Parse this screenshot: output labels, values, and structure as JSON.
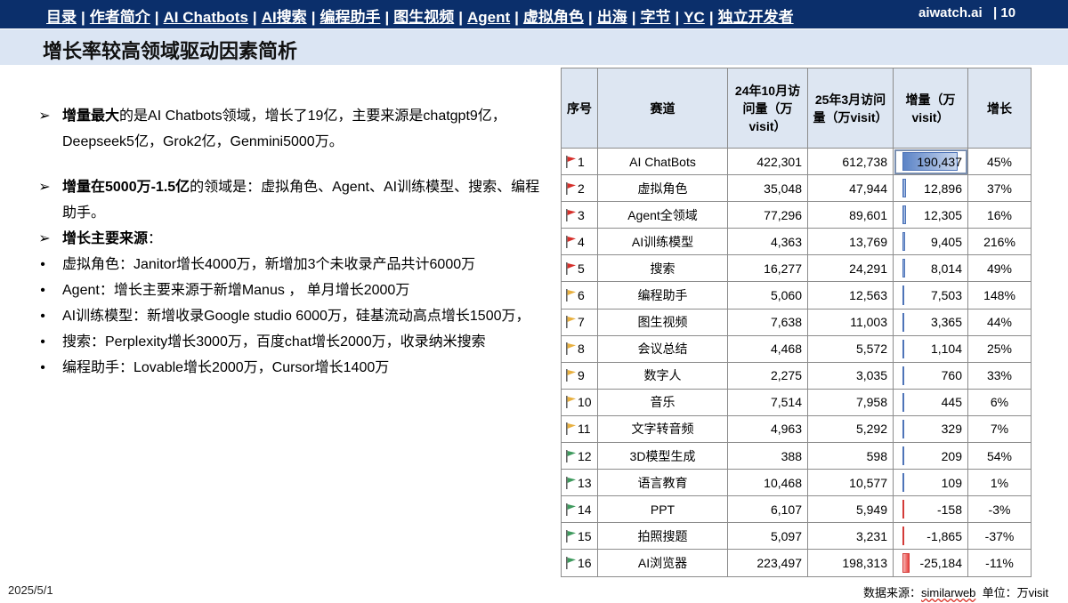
{
  "nav": {
    "items": [
      "目录",
      "作者简介",
      "AI Chatbots",
      "AI搜索",
      "编程助手",
      "图生视频",
      "Agent",
      "虚拟角色",
      "出海",
      "字节",
      "YC",
      "独立开发者"
    ],
    "separator": "|",
    "brand": "aiwatch.ai",
    "page": "10"
  },
  "title": "增长率较高领域驱动因素简析",
  "left": {
    "p1": {
      "bold": "增量最大",
      "rest": "的是AI Chatbots领域，增长了19亿，主要来源是chatgpt9亿，Deepseek5亿，Grok2亿，Genmini5000万。"
    },
    "p2": {
      "bold": "增量在5000万-1.5亿",
      "rest": "的领域是：虚拟角色、Agent、AI训练模型、搜索、编程助手。"
    },
    "p3": {
      "bold": "增长主要来源",
      "rest": "："
    },
    "arrow_marker": "➢",
    "dot_marker": "•",
    "subs": [
      "虚拟角色：Janitor增长4000万，新增加3个未收录产品共计6000万",
      "Agent：增长主要来源于新增Manus ， 单月增长2000万",
      "AI训练模型：新增收录Google studio 6000万，硅基流动高点增长1500万，",
      "搜索：Perplexity增长3000万，百度chat增长2000万，收录纳米搜索",
      "编程助手：Lovable增长2000万，Cursor增长1400万"
    ]
  },
  "table": {
    "headers": [
      "序号",
      "赛道",
      "24年10月访问量（万visit）",
      "25年3月访问量（万visit）",
      "增量（万visit）",
      "增长"
    ],
    "rows": [
      {
        "idx": "1",
        "name": "AI ChatBots",
        "oct": "422,301",
        "mar": "612,738",
        "inc": "190,437",
        "growth": "45%",
        "flag": "#d6302b",
        "inc_value": 190437
      },
      {
        "idx": "2",
        "name": "虚拟角色",
        "oct": "35,048",
        "mar": "47,944",
        "inc": "12,896",
        "growth": "37%",
        "flag": "#d6302b",
        "inc_value": 12896
      },
      {
        "idx": "3",
        "name": "Agent全领域",
        "oct": "77,296",
        "mar": "89,601",
        "inc": "12,305",
        "growth": "16%",
        "flag": "#d6302b",
        "inc_value": 12305
      },
      {
        "idx": "4",
        "name": "AI训练模型",
        "oct": "4,363",
        "mar": "13,769",
        "inc": "9,405",
        "growth": "216%",
        "flag": "#d6302b",
        "inc_value": 9405
      },
      {
        "idx": "5",
        "name": "搜索",
        "oct": "16,277",
        "mar": "24,291",
        "inc": "8,014",
        "growth": "49%",
        "flag": "#d6302b",
        "inc_value": 8014
      },
      {
        "idx": "6",
        "name": "编程助手",
        "oct": "5,060",
        "mar": "12,563",
        "inc": "7,503",
        "growth": "148%",
        "flag": "#e8b040",
        "inc_value": 7503
      },
      {
        "idx": "7",
        "name": "图生视频",
        "oct": "7,638",
        "mar": "11,003",
        "inc": "3,365",
        "growth": "44%",
        "flag": "#e8b040",
        "inc_value": 3365
      },
      {
        "idx": "8",
        "name": "会议总结",
        "oct": "4,468",
        "mar": "5,572",
        "inc": "1,104",
        "growth": "25%",
        "flag": "#e8b040",
        "inc_value": 1104
      },
      {
        "idx": "9",
        "name": "数字人",
        "oct": "2,275",
        "mar": "3,035",
        "inc": "760",
        "growth": "33%",
        "flag": "#e8b040",
        "inc_value": 760
      },
      {
        "idx": "10",
        "name": "音乐",
        "oct": "7,514",
        "mar": "7,958",
        "inc": "445",
        "growth": "6%",
        "flag": "#e8b040",
        "inc_value": 445
      },
      {
        "idx": "11",
        "name": "文字转音频",
        "oct": "4,963",
        "mar": "5,292",
        "inc": "329",
        "growth": "7%",
        "flag": "#e8b040",
        "inc_value": 329
      },
      {
        "idx": "12",
        "name": "3D模型生成",
        "oct": "388",
        "mar": "598",
        "inc": "209",
        "growth": "54%",
        "flag": "#3f9a5e",
        "inc_value": 209
      },
      {
        "idx": "13",
        "name": "语言教育",
        "oct": "10,468",
        "mar": "10,577",
        "inc": "109",
        "growth": "1%",
        "flag": "#3f9a5e",
        "inc_value": 109
      },
      {
        "idx": "14",
        "name": "PPT",
        "oct": "6,107",
        "mar": "5,949",
        "inc": "-158",
        "growth": "-3%",
        "flag": "#3f9a5e",
        "inc_value": -158
      },
      {
        "idx": "15",
        "name": "拍照搜题",
        "oct": "5,097",
        "mar": "3,231",
        "inc": "-1,865",
        "growth": "-37%",
        "flag": "#3f9a5e",
        "inc_value": -1865
      },
      {
        "idx": "16",
        "name": "AI浏览器",
        "oct": "223,497",
        "mar": "198,313",
        "inc": "-25,184",
        "growth": "-11%",
        "flag": "#3f9a5e",
        "inc_value": -25184
      }
    ]
  },
  "footer": {
    "date": "2025/5/1",
    "source_prefix": "数据来源：",
    "source_name": "similarweb",
    "unit": "单位：万visit"
  }
}
